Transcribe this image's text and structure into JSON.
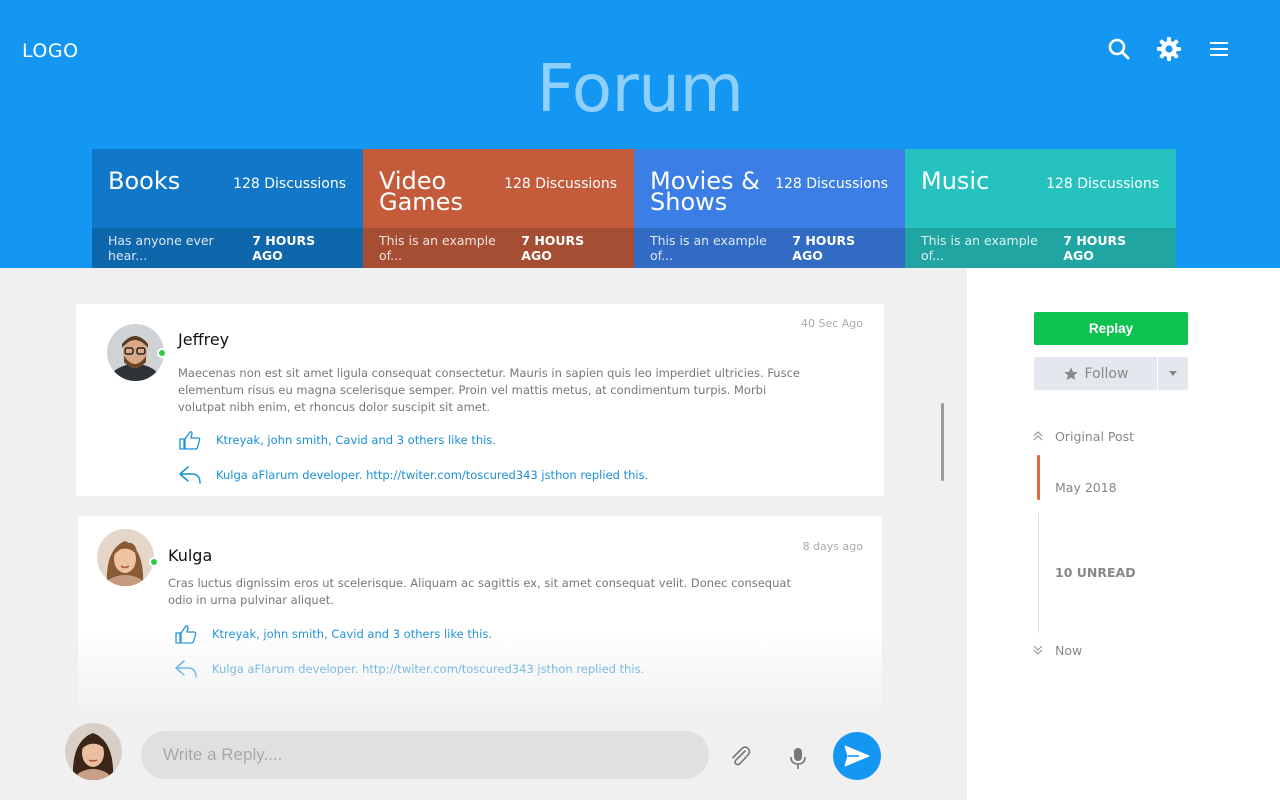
{
  "header": {
    "logo": "LOGO",
    "title": "Forum"
  },
  "categories": [
    {
      "name": "Books",
      "count": "128 Discussions",
      "excerpt": "Has anyone ever hear...",
      "time": "7 HOURS AGO",
      "color": "#1178c9"
    },
    {
      "name": "Video Games",
      "count": "128 Discussions",
      "excerpt": "This is an example of...",
      "time": "7 HOURS AGO",
      "color": "#c45c3c"
    },
    {
      "name": "Movies & Shows",
      "count": "128 Discussions",
      "excerpt": "This is an example of...",
      "time": "7 HOURS AGO",
      "color": "#3a7ee6"
    },
    {
      "name": "Music",
      "count": "128 Discussions",
      "excerpt": "This is an example of...",
      "time": "7 HOURS AGO",
      "color": "#26c2c0"
    }
  ],
  "posts": [
    {
      "author": "Jeffrey",
      "time": "40 Sec Ago",
      "body": "Maecenas non est sit amet ligula consequat consectetur. Mauris in sapien quis leo imperdiet ultricies. Fusce elementum risus eu magna scelerisque semper. Proin vel mattis metus, at condimentum turpis. Morbi volutpat nibh enim, et rhoncus dolor suscipit sit amet.",
      "likes": "Ktreyak, john smith, Cavid and 3 others like this.",
      "replies": "Kulga aFlarum developer. http://twiter.com/toscured343 jsthon replied this."
    },
    {
      "author": "Kulga",
      "time": "8 days ago",
      "body": "Cras luctus dignissim eros ut scelerisque. Aliquam ac sagittis ex, sit amet consequat velit. Donec consequat odio in urna pulvinar aliquet.",
      "likes": "Ktreyak, john smith, Cavid and 3 others like this.",
      "replies": "Kulga aFlarum developer. http://twiter.com/toscured343 jsthon replied this."
    }
  ],
  "reply": {
    "placeholder": "Write a Reply...."
  },
  "sidebar": {
    "replay_label": "Replay",
    "follow_label": "Follow",
    "timeline": {
      "original_post": "Original Post",
      "current": "May 2018",
      "unread": "10 UNREAD",
      "now": "Now"
    }
  },
  "colors": {
    "header_bg": "#1497f3",
    "replay_btn": "#0cc34f",
    "link": "#1a8fd6",
    "online": "#2ecc40",
    "timeline_active": "#e06a3b"
  }
}
